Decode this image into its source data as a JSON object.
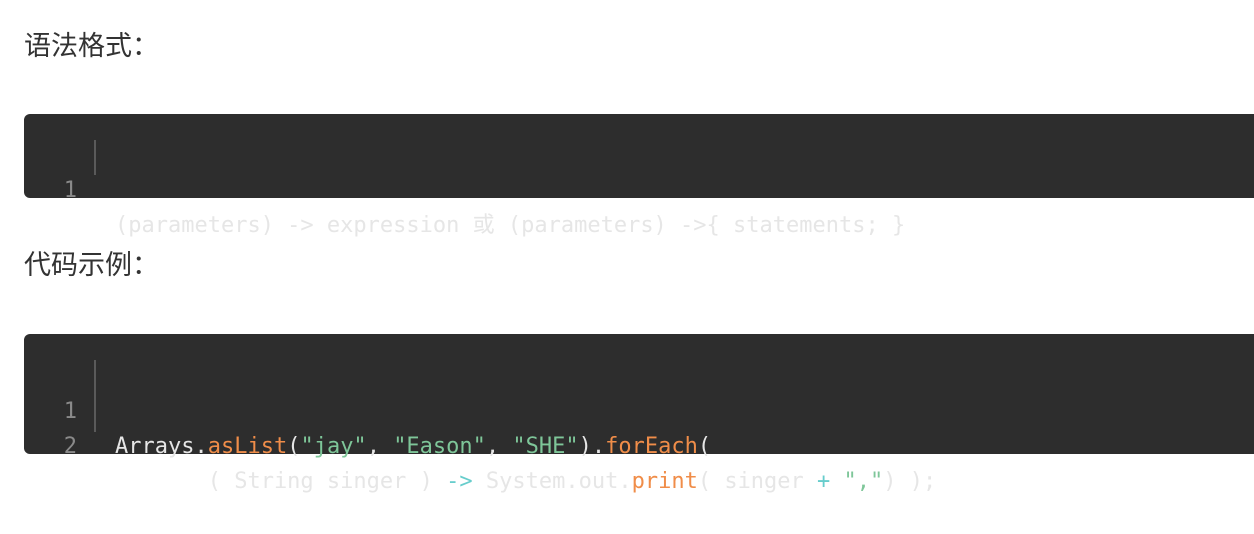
{
  "headings": {
    "syntax": "语法格式：",
    "example": "代码示例："
  },
  "syntax_block": {
    "line_numbers": [
      "1"
    ],
    "line1": "(parameters) -> expression 或 (parameters) ->{ statements; }"
  },
  "example_block": {
    "line_numbers": [
      "1",
      "2"
    ],
    "line1": {
      "t1": "Arrays.",
      "t2": "asList",
      "t3": "(",
      "t4": "\"jay\"",
      "t5": ", ",
      "t6": "\"Eason\"",
      "t7": ", ",
      "t8": "\"SHE\"",
      "t9": ").",
      "t10": "forEach",
      "t11": "("
    },
    "line2": {
      "t1": "       ( String singer ) ",
      "t2": "->",
      "t3": " System.out.",
      "t4": "print",
      "t5": "( singer ",
      "t6": "+",
      "t7": " ",
      "t8": "\",\"",
      "t9": ") );"
    }
  },
  "colors": {
    "code_background": "#2d2d2d",
    "code_text": "#e6e6e6",
    "function": "#f08d49",
    "string": "#7ec699",
    "operator": "#67cdcc"
  }
}
